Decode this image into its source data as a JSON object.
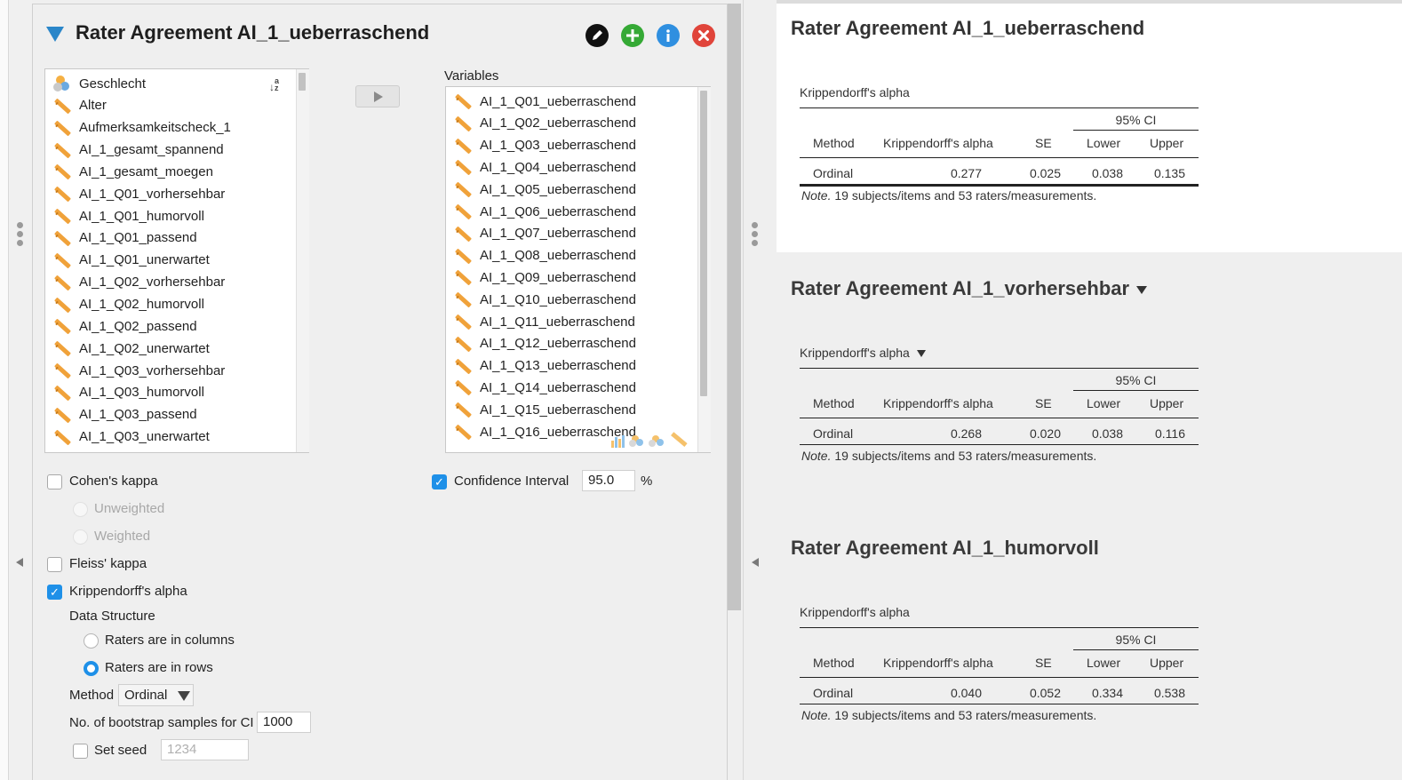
{
  "analysis": {
    "title": "Rater Agreement AI_1_ueberraschend",
    "icons": [
      "edit-icon",
      "add-icon",
      "info-icon",
      "close-icon"
    ]
  },
  "available_list": {
    "items": [
      {
        "label": "Geschlecht",
        "type": "nominal"
      },
      {
        "label": "Alter",
        "type": "scale"
      },
      {
        "label": "Aufmerksamkeitscheck_1",
        "type": "scale"
      },
      {
        "label": "AI_1_gesamt_spannend",
        "type": "scale"
      },
      {
        "label": "AI_1_gesamt_moegen",
        "type": "scale"
      },
      {
        "label": "AI_1_Q01_vorhersehbar",
        "type": "scale"
      },
      {
        "label": "AI_1_Q01_humorvoll",
        "type": "scale"
      },
      {
        "label": "AI_1_Q01_passend",
        "type": "scale"
      },
      {
        "label": "AI_1_Q01_unerwartet",
        "type": "scale"
      },
      {
        "label": "AI_1_Q02_vorhersehbar",
        "type": "scale"
      },
      {
        "label": "AI_1_Q02_humorvoll",
        "type": "scale"
      },
      {
        "label": "AI_1_Q02_passend",
        "type": "scale"
      },
      {
        "label": "AI_1_Q02_unerwartet",
        "type": "scale"
      },
      {
        "label": "AI_1_Q03_vorhersehbar",
        "type": "scale"
      },
      {
        "label": "AI_1_Q03_humorvoll",
        "type": "scale"
      },
      {
        "label": "AI_1_Q03_passend",
        "type": "scale"
      },
      {
        "label": "AI_1_Q03_unerwartet",
        "type": "scale"
      }
    ],
    "sort_glyph": "↓a z"
  },
  "variables_box": {
    "label": "Variables",
    "items": [
      "AI_1_Q01_ueberraschend",
      "AI_1_Q02_ueberraschend",
      "AI_1_Q03_ueberraschend",
      "AI_1_Q04_ueberraschend",
      "AI_1_Q05_ueberraschend",
      "AI_1_Q06_ueberraschend",
      "AI_1_Q07_ueberraschend",
      "AI_1_Q08_ueberraschend",
      "AI_1_Q09_ueberraschend",
      "AI_1_Q10_ueberraschend",
      "AI_1_Q11_ueberraschend",
      "AI_1_Q12_ueberraschend",
      "AI_1_Q13_ueberraschend",
      "AI_1_Q14_ueberraschend",
      "AI_1_Q15_ueberraschend",
      "AI_1_Q16_ueberraschend"
    ]
  },
  "options": {
    "cohens_kappa": "Cohen's kappa",
    "unweighted": "Unweighted",
    "weighted": "Weighted",
    "fleiss_kappa": "Fleiss' kappa",
    "krippendorff": "Krippendorff's alpha",
    "data_structure": "Data Structure",
    "raters_columns": "Raters are in columns",
    "raters_rows": "Raters are in rows",
    "method_label": "Method",
    "method_value": "Ordinal",
    "bootstrap_label": "No. of bootstrap samples for CI",
    "bootstrap_value": "1000",
    "set_seed": "Set seed",
    "seed_placeholder": "1234",
    "ci_label": "Confidence Interval",
    "ci_value": "95.0",
    "ci_unit": "%"
  },
  "results": [
    {
      "title": "Rater Agreement AI_1_ueberraschend",
      "subtitle": "Krippendorff's alpha",
      "ci_header": "95% CI",
      "headers": [
        "Method",
        "Krippendorff's alpha",
        "SE",
        "Lower",
        "Upper"
      ],
      "row": [
        "Ordinal",
        "0.277",
        "0.025",
        "0.038",
        "0.135"
      ],
      "note_prefix": "Note.",
      "note": " 19 subjects/items and 53 raters/measurements."
    },
    {
      "title": "Rater Agreement AI_1_vorhersehbar",
      "subtitle": "Krippendorff's alpha",
      "ci_header": "95% CI",
      "headers": [
        "Method",
        "Krippendorff's alpha",
        "SE",
        "Lower",
        "Upper"
      ],
      "row": [
        "Ordinal",
        "0.268",
        "0.020",
        "0.038",
        "0.116"
      ],
      "note_prefix": "Note.",
      "note": " 19 subjects/items and 53 raters/measurements."
    },
    {
      "title": "Rater Agreement AI_1_humorvoll",
      "subtitle": "Krippendorff's alpha",
      "ci_header": "95% CI",
      "headers": [
        "Method",
        "Krippendorff's alpha",
        "SE",
        "Lower",
        "Upper"
      ],
      "row": [
        "Ordinal",
        "0.040",
        "0.052",
        "0.334",
        "0.538"
      ],
      "note_prefix": "Note.",
      "note": " 19 subjects/items and 53 raters/measurements."
    }
  ]
}
